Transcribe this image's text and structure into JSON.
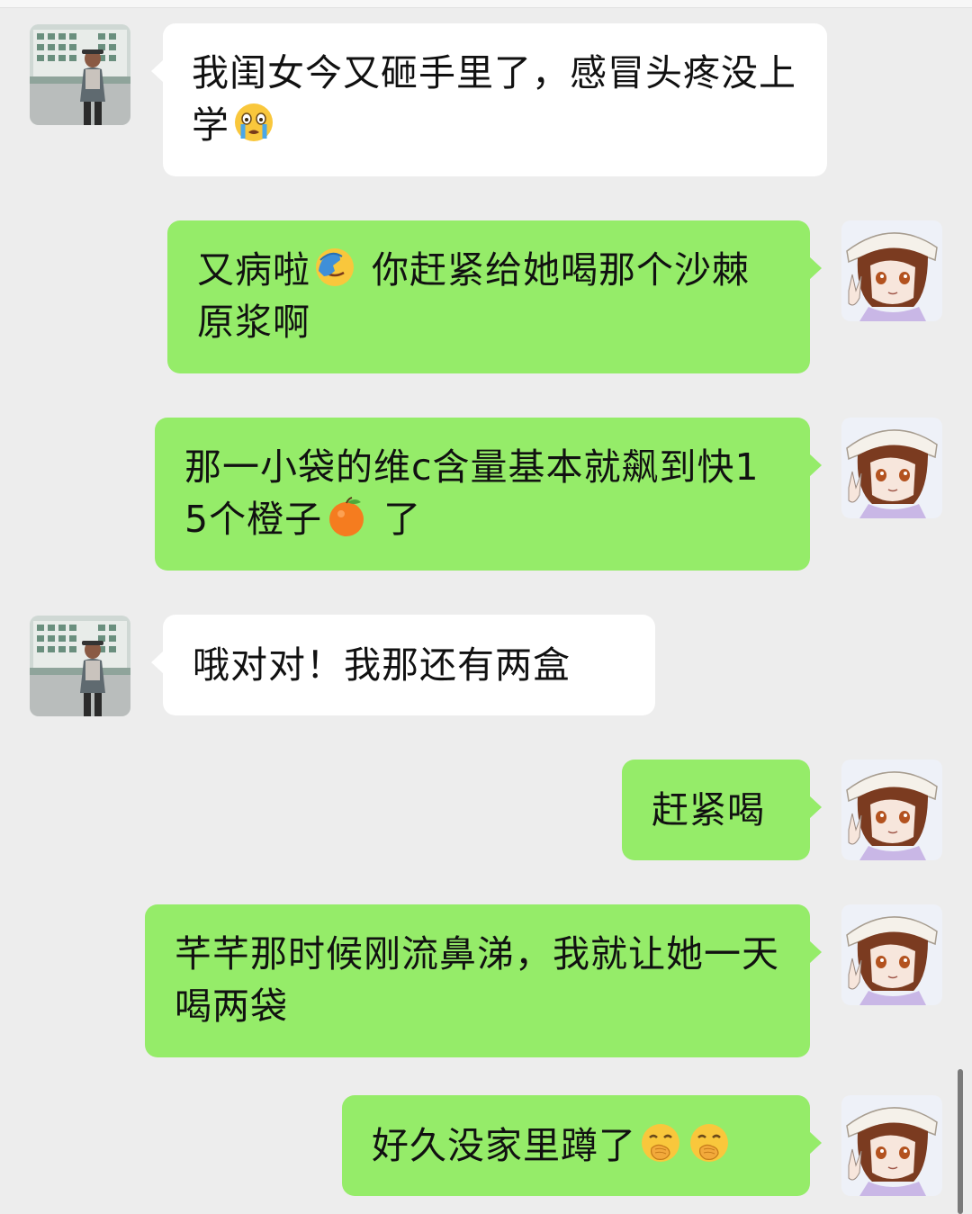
{
  "messages": [
    {
      "side": "in",
      "parts": [
        "我闺女今又砸手里了，感冒头疼没上学",
        "loudly-crying-emoji"
      ]
    },
    {
      "side": "out",
      "parts": [
        "又病啦",
        "face-palm-emoji",
        " 你赶紧给她喝那个沙棘原浆啊"
      ]
    },
    {
      "side": "out",
      "parts": [
        "那一小袋的维c含量基本就飙到快15个橙子",
        "orange-emoji",
        " 了"
      ]
    },
    {
      "side": "in",
      "parts": [
        "哦对对！我那还有两盒"
      ]
    },
    {
      "side": "out",
      "parts": [
        "赶紧喝"
      ]
    },
    {
      "side": "out",
      "parts": [
        "芊芊那时候刚流鼻涕，我就让她一天喝两袋"
      ]
    },
    {
      "side": "out",
      "parts": [
        "好久没家里蹲了",
        "hand-over-mouth-emoji",
        "hand-over-mouth-emoji"
      ]
    }
  ],
  "m": {
    "m1": {
      "t1": "我闺女今又砸手里了，感冒头疼没上学",
      "e1": "loudly-crying-emoji"
    },
    "m2": {
      "t1": "又病啦",
      "e1": "face-palm-emoji",
      "t2": " 你赶紧给她喝那个沙棘原浆啊"
    },
    "m3": {
      "t1": "那一小袋的维c含量基本就飙到快15个橙子",
      "e1": "orange-emoji",
      "t2": " 了"
    },
    "m4": {
      "t1": "哦对对！我那还有两盒"
    },
    "m5": {
      "t1": "赶紧喝"
    },
    "m6": {
      "t1": "芊芊那时候刚流鼻涕，我就让她一天喝两袋"
    },
    "m7": {
      "t1": "好久没家里蹲了",
      "e1": "hand-over-mouth-emoji",
      "e2": "hand-over-mouth-emoji"
    }
  },
  "avatars": {
    "contact": "contact-avatar",
    "self": "self-avatar"
  },
  "colors": {
    "background": "#ededed",
    "incoming_bubble": "#ffffff",
    "outgoing_bubble": "#95ec69"
  }
}
